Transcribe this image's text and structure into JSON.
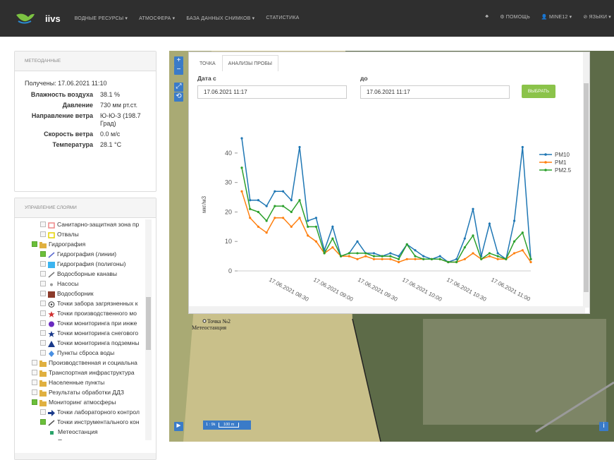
{
  "header": {
    "brand": "iivs",
    "nav": [
      "ВОДНЫЕ РЕСУРСЫ ▾",
      "АТМОСФЕРА ▾",
      "БАЗА ДАННЫХ СНИМКОВ ▾",
      "СТАТИСТИКА"
    ],
    "right": [
      "♣",
      "⚙ ПОМОЩЬ",
      "👤 MINE12 ▾",
      "⊘ ЯЗЫКИ ▾"
    ]
  },
  "meteo": {
    "title": "МЕТЕОДАННЫЕ",
    "received": "Получены: 17.06.2021 11:10",
    "rows": [
      {
        "k": "Влажность воздуха",
        "v": "38.1 %"
      },
      {
        "k": "Давление",
        "v": "730 мм рт.ст."
      },
      {
        "k": "Направление ветра",
        "v": "Ю-Ю-З (198.7 Град)"
      },
      {
        "k": "Скорость ветра",
        "v": "0.0 м/с"
      },
      {
        "k": "Температура",
        "v": "28.1 °C"
      }
    ]
  },
  "layers": {
    "title": "УПРАВЛЕНИЕ СЛОЯМИ",
    "items": [
      {
        "label": "Санитарно-защитная зона пр",
        "indent": 2,
        "checked": false,
        "icon": "box-outline-icon",
        "color": "#e88"
      },
      {
        "label": "Отвалы",
        "indent": 2,
        "checked": false,
        "icon": "box-outline-icon",
        "color": "#e6d200"
      },
      {
        "label": "Гидрография",
        "indent": 1,
        "checked": true,
        "icon": "folder-icon",
        "color": "#e0b040"
      },
      {
        "label": "Гидрография (линии)",
        "indent": 2,
        "checked": true,
        "icon": "line-icon",
        "color": "#5a6ad0"
      },
      {
        "label": "Гидрография (полигоны)",
        "indent": 2,
        "checked": false,
        "icon": "polygon-icon",
        "color": "#3cb4f0"
      },
      {
        "label": "Водосборные канавы",
        "indent": 2,
        "checked": false,
        "icon": "line-icon",
        "color": "#777"
      },
      {
        "label": "Насосы",
        "indent": 2,
        "checked": false,
        "icon": "dot-icon",
        "color": "#999"
      },
      {
        "label": "Водосборник",
        "indent": 2,
        "checked": false,
        "icon": "polygon-icon",
        "color": "#8b3a2a"
      },
      {
        "label": "Точки забора загрязненных к",
        "indent": 2,
        "checked": false,
        "icon": "target-icon",
        "color": "#333"
      },
      {
        "label": "Точки производственного мо",
        "indent": 2,
        "checked": false,
        "icon": "star-icon",
        "color": "#d03030"
      },
      {
        "label": "Точки мониторинга при инже",
        "indent": 2,
        "checked": false,
        "icon": "circle-icon",
        "color": "#6a2ac0"
      },
      {
        "label": "Точки мониторинга снегового",
        "indent": 2,
        "checked": false,
        "icon": "star-icon",
        "color": "#1a3a8a"
      },
      {
        "label": "Точки мониторинга подземны",
        "indent": 2,
        "checked": false,
        "icon": "triangle-icon",
        "color": "#1a3a8a"
      },
      {
        "label": "Пункты сброса воды",
        "indent": 2,
        "checked": false,
        "icon": "diamond-icon",
        "color": "#4a90e2"
      },
      {
        "label": "Производственная и социальна",
        "indent": 1,
        "checked": false,
        "icon": "folder-icon",
        "color": "#e0b040"
      },
      {
        "label": "Транспортная инфраструктура",
        "indent": 1,
        "checked": false,
        "icon": "folder-icon",
        "color": "#e0b040"
      },
      {
        "label": "Населенные пункты",
        "indent": 1,
        "checked": false,
        "icon": "folder-icon",
        "color": "#e0b040"
      },
      {
        "label": "Результаты обработки ДДЗ",
        "indent": 1,
        "checked": false,
        "icon": "folder-icon",
        "color": "#e0b040"
      },
      {
        "label": "Мониторинг атмосферы",
        "indent": 1,
        "checked": true,
        "icon": "folder-icon",
        "color": "#e0b040"
      },
      {
        "label": "Точки лабораторного контрол",
        "indent": 2,
        "checked": false,
        "icon": "arrow-icon",
        "color": "#1a3a8a"
      },
      {
        "label": "Точки инструментального кон",
        "indent": 2,
        "checked": true,
        "icon": "line-icon",
        "color": "#555"
      },
      {
        "label": "Метеостанция",
        "indent": 3,
        "checked": null,
        "icon": "square-icon",
        "color": "#2aa36a"
      },
      {
        "label": "Пылевые датчики",
        "indent": 3,
        "checked": null,
        "icon": "square-icon",
        "color": "#3a6ac8"
      }
    ]
  },
  "popup": {
    "tabs": [
      "ТОЧКА",
      "АНАЛИЗЫ ПРОБЫ"
    ],
    "date_from_label": "Дата с",
    "date_to_label": "до",
    "date_from": "17.06.2021 11:17",
    "date_to": "17.06.2021 11:17",
    "select_button": "ВЫБРАТЬ"
  },
  "map": {
    "label_point": "Точка №2",
    "label_station": "Метеостанция",
    "scale_text": "1 : 9k",
    "scale_bar": "100 m"
  },
  "chart_data": {
    "type": "line",
    "title": "",
    "ylabel": "мкг/м3",
    "xlabel": "",
    "ylim": [
      0,
      45
    ],
    "yticks": [
      0,
      10,
      20,
      30,
      40
    ],
    "xticks": [
      "17.06.2021 08:30",
      "17.06.2021 09:00",
      "17.06.2021 09:30",
      "17.06.2021 10:00",
      "17.06.2021 10:30",
      "17.06.2021 11:00"
    ],
    "legend_position": "right",
    "series": [
      {
        "name": "PM10",
        "color": "#1f77b4",
        "values": [
          45,
          24,
          24,
          22,
          27,
          27,
          24,
          42,
          17,
          18,
          7,
          15,
          5,
          6,
          10,
          6,
          6,
          5,
          6,
          5,
          9,
          7,
          5,
          4,
          5,
          3,
          4,
          11,
          21,
          5,
          16,
          6,
          4,
          17,
          42,
          4
        ]
      },
      {
        "name": "PM1",
        "color": "#ff7f0e",
        "values": [
          27,
          18,
          15,
          13,
          18,
          18,
          15,
          18,
          12,
          10,
          6,
          8,
          5,
          5,
          4,
          5,
          4,
          4,
          4,
          3,
          4,
          4,
          4,
          4,
          4,
          3,
          3,
          4,
          6,
          4,
          5,
          4,
          4,
          6,
          7,
          3
        ]
      },
      {
        "name": "PM2.5",
        "color": "#2ca02c",
        "values": [
          35,
          21,
          20,
          17,
          22,
          22,
          20,
          24,
          15,
          15,
          6,
          11,
          5,
          6,
          6,
          6,
          5,
          5,
          5,
          4,
          9,
          5,
          4,
          4,
          4,
          3,
          3,
          8,
          12,
          4,
          6,
          5,
          4,
          10,
          13,
          4
        ]
      }
    ]
  }
}
